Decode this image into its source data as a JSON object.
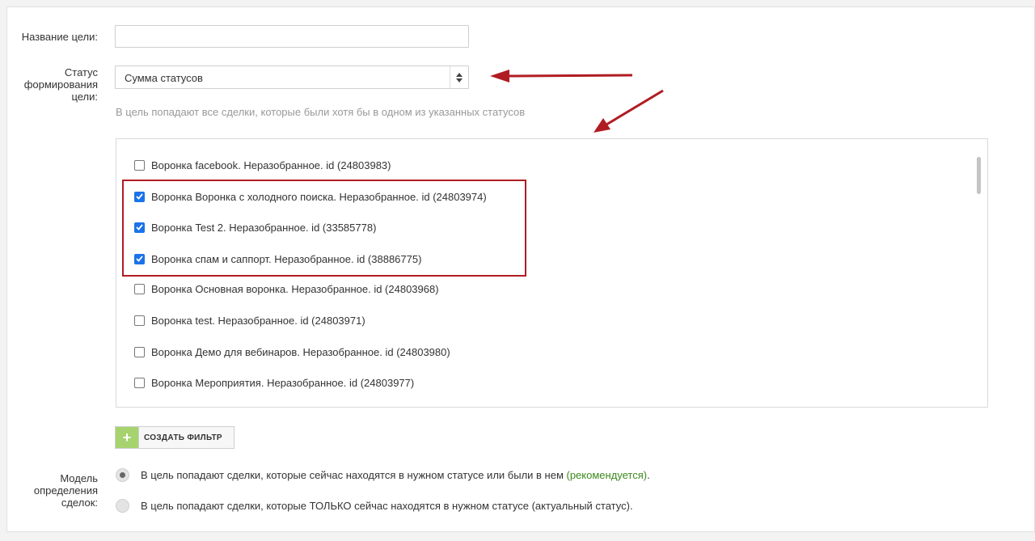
{
  "goal_name": {
    "label": "Название цели:",
    "value": "",
    "placeholder": ""
  },
  "status_field": {
    "label_lines": [
      "Статус",
      "формирования",
      "цели:"
    ],
    "selected": "Сумма статусов",
    "hint": "В цель попадают все сделки, которые были хотя бы в одном из указанных статусов"
  },
  "statuses": [
    {
      "text": "Воронка facebook. Неразобранное. id (24803983)",
      "checked": false
    },
    {
      "text": "Воронка Воронка с холодного поиска. Неразобранное. id (24803974)",
      "checked": true
    },
    {
      "text": "Воронка Test 2. Неразобранное. id (33585778)",
      "checked": true
    },
    {
      "text": "Воронка спам и саппорт. Неразобранное. id (38886775)",
      "checked": true
    },
    {
      "text": "Воронка Основная воронка. Неразобранное. id (24803968)",
      "checked": false
    },
    {
      "text": "Воронка test. Неразобранное. id (24803971)",
      "checked": false
    },
    {
      "text": "Воронка Демо для вебинаров. Неразобранное. id (24803980)",
      "checked": false
    },
    {
      "text": "Воронка Мероприятия. Неразобранное. id (24803977)",
      "checked": false
    }
  ],
  "create_filter": {
    "icon": "plus-icon",
    "label": "СОЗДАТЬ ФИЛЬТР"
  },
  "model": {
    "label_lines": [
      "Модель",
      "определения",
      "сделок:"
    ],
    "options": [
      {
        "text": "В цель попадают сделки, которые сейчас находятся в нужном статусе или были в нем ",
        "note": "(рекомендуется)",
        "tail": ".",
        "selected": true
      },
      {
        "text": "В цель попадают сделки, которые ТОЛЬКО сейчас находятся в нужном статусе (актуальный статус).",
        "note": "",
        "tail": "",
        "selected": false
      }
    ]
  },
  "colors": {
    "accent_red": "#b01c22",
    "checkbox_blue": "#1a73e8",
    "plus_green": "#a6d36e",
    "recommend_green": "#3b8a1c"
  }
}
